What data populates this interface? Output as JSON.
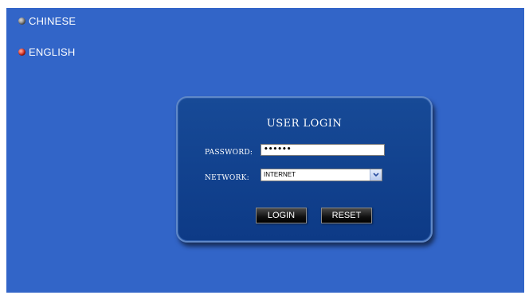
{
  "languages": {
    "chinese": "CHINESE",
    "english": "ENGLISH"
  },
  "login": {
    "title": "USER LOGIN",
    "password_label": "PASSWORD:",
    "password_value": "••••••",
    "network_label": "NETWORK:",
    "network_value": "INTERNET",
    "login_button": "LOGIN",
    "reset_button": "RESET"
  },
  "colors": {
    "background": "#3265c8",
    "panel": "#0d3a86",
    "selected_language_dot": "#e0281a",
    "unselected_language_dot": "#6e6e6e"
  },
  "icons": {
    "chinese_indicator": "grey-dot-icon",
    "english_indicator": "red-dot-icon",
    "network_dropdown": "chevron-down-icon"
  }
}
